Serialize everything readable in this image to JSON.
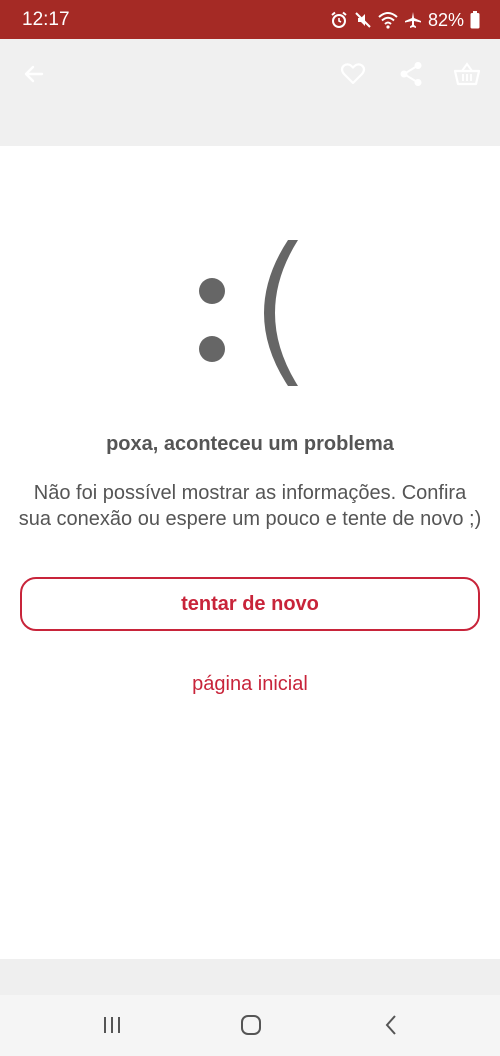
{
  "status_bar": {
    "time": "12:17",
    "battery_percent": "82%",
    "icons": [
      "alarm-icon",
      "mute-icon",
      "wifi-icon",
      "airplane-icon",
      "battery-icon"
    ]
  },
  "app_bar": {
    "icons": [
      "back-arrow-icon",
      "heart-icon",
      "share-icon",
      "basket-icon"
    ]
  },
  "error": {
    "emoticon": ":(",
    "title": "poxa, aconteceu um problema",
    "message_line1": "Não foi possível mostrar as informações. Confira",
    "message_line2": "sua conexão ou espere um pouco e tente de novo ;)",
    "retry_label": "tentar de novo",
    "home_label": "página inicial"
  },
  "nav_bar": {
    "icons": [
      "recent-apps-icon",
      "home-icon",
      "back-icon"
    ]
  },
  "colors": {
    "status_bar": "#a52a25",
    "accent": "#c8243a",
    "text": "#555555",
    "app_bar": "#f0f0f0"
  }
}
